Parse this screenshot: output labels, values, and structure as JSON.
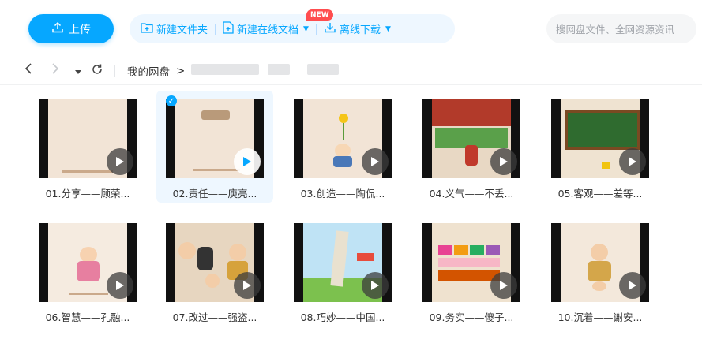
{
  "toolbar": {
    "upload": "上传",
    "new_folder": "新建文件夹",
    "new_online_doc": "新建在线文档",
    "new_badge": "NEW",
    "offline_download": "离线下载",
    "search_placeholder": "搜网盘文件、全网资源资讯"
  },
  "breadcrumb": {
    "root": "我的网盘",
    "separator": ">"
  },
  "files": [
    {
      "name": "01.分享——顾荣...",
      "selected": false
    },
    {
      "name": "02.责任——庾亮...",
      "selected": true
    },
    {
      "name": "03.创造——陶侃...",
      "selected": false
    },
    {
      "name": "04.义气——不丢...",
      "selected": false
    },
    {
      "name": "05.客观——差等...",
      "selected": false
    },
    {
      "name": "06.智慧——孔融...",
      "selected": false
    },
    {
      "name": "07.改过——强盗...",
      "selected": false
    },
    {
      "name": "08.巧妙——中国...",
      "selected": false
    },
    {
      "name": "09.务实——傻子...",
      "selected": false
    },
    {
      "name": "10.沉着——谢安...",
      "selected": false
    }
  ],
  "colors": {
    "accent": "#06a7ff",
    "pale_accent": "#eef7ff",
    "new_badge": "#ff4d4f"
  }
}
